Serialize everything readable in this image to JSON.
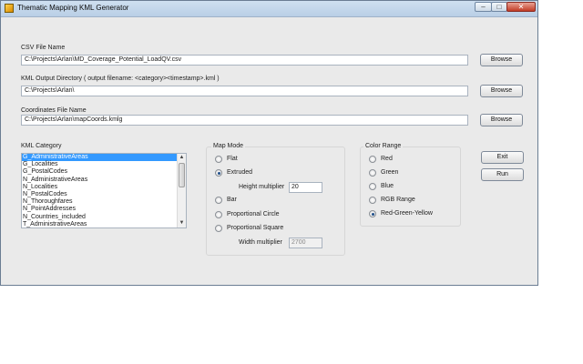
{
  "window": {
    "title": "Thematic Mapping KML Generator"
  },
  "csv": {
    "label": "CSV File Name",
    "value": "C:\\Projects\\Arlan\\MD_Coverage_Potential_LoadQV.csv",
    "browse": "Browse"
  },
  "kml_output": {
    "label": "KML Output Directory ( output filename: <category><timestamp>.kml )",
    "value": "C:\\Projects\\Arlan\\",
    "browse": "Browse"
  },
  "coords": {
    "label": "Coordinates File Name",
    "value": "C:\\Projects\\Arlan\\mapCoords.kmlg",
    "browse": "Browse"
  },
  "category": {
    "label": "KML Category",
    "items": [
      "G_AdministrativeAreas",
      "G_Localities",
      "G_PostalCodes",
      "N_AdministrativeAreas",
      "N_Localities",
      "N_PostalCodes",
      "N_Thoroughfares",
      "N_PointAddresses",
      "N_Countries_included",
      "T_AdministrativeAreas"
    ],
    "selected_index": 0
  },
  "map_mode": {
    "label": "Map Mode",
    "options": [
      "Flat",
      "Extruded",
      "Bar",
      "Proportional Circle",
      "Proportional Square"
    ],
    "selected": "Extruded",
    "height_label": "Height multiplier",
    "height_value": "20",
    "width_label": "Width multiplier",
    "width_value": "2700"
  },
  "color_range": {
    "label": "Color Range",
    "options": [
      "Red",
      "Green",
      "Blue",
      "RGB Range",
      "Red-Green-Yellow"
    ],
    "selected": "Red-Green-Yellow"
  },
  "actions": {
    "exit": "Exit",
    "run": "Run"
  },
  "icons": {
    "app": "app-icon",
    "minimize": "minimize-icon",
    "maximize": "maximize-icon",
    "close": "close-icon"
  }
}
